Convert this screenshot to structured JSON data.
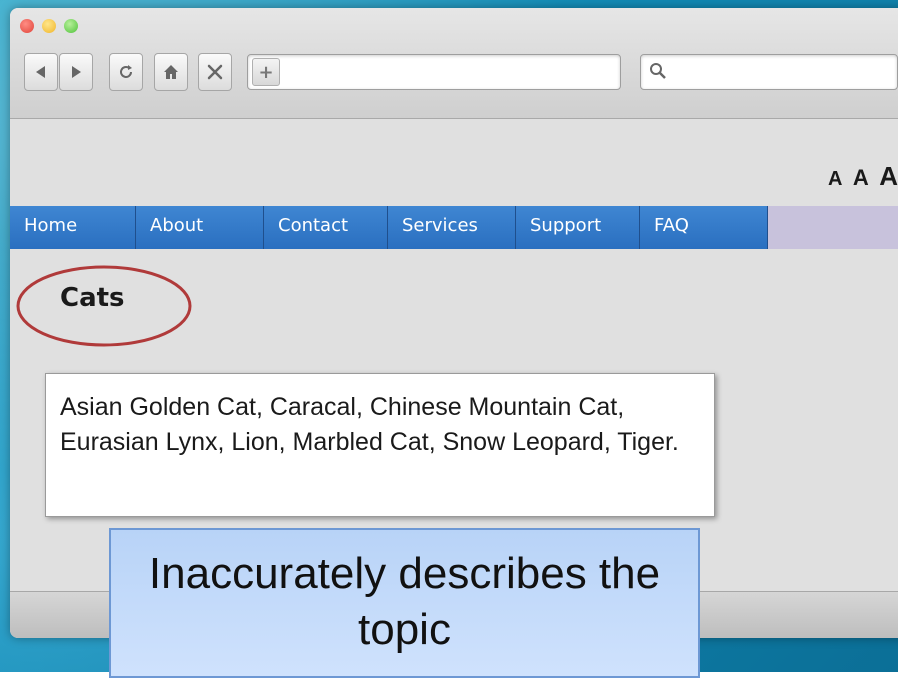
{
  "browser": {
    "address_value": "",
    "search_value": ""
  },
  "page": {
    "font_size_controls": [
      "A",
      "A",
      "A"
    ],
    "nav": [
      {
        "label": "Home"
      },
      {
        "label": "About"
      },
      {
        "label": "Contact"
      },
      {
        "label": "Services"
      },
      {
        "label": "Support"
      },
      {
        "label": "FAQ"
      }
    ],
    "heading": "Cats",
    "description": "Asian Golden Cat, Caracal, Chinese Mountain Cat, Eurasian Lynx, Lion, Marbled Cat, Snow Leopard, Tiger."
  },
  "callout": {
    "text": "Inaccurately describes the topic"
  },
  "colors": {
    "nav_blue": "#3f86d2",
    "circle_red": "#b03a3a",
    "callout_blue": "#cfe2fd"
  },
  "icons": [
    "back-icon",
    "forward-icon",
    "reload-icon",
    "home-icon",
    "close-icon",
    "add-bookmark-icon",
    "search-icon"
  ]
}
